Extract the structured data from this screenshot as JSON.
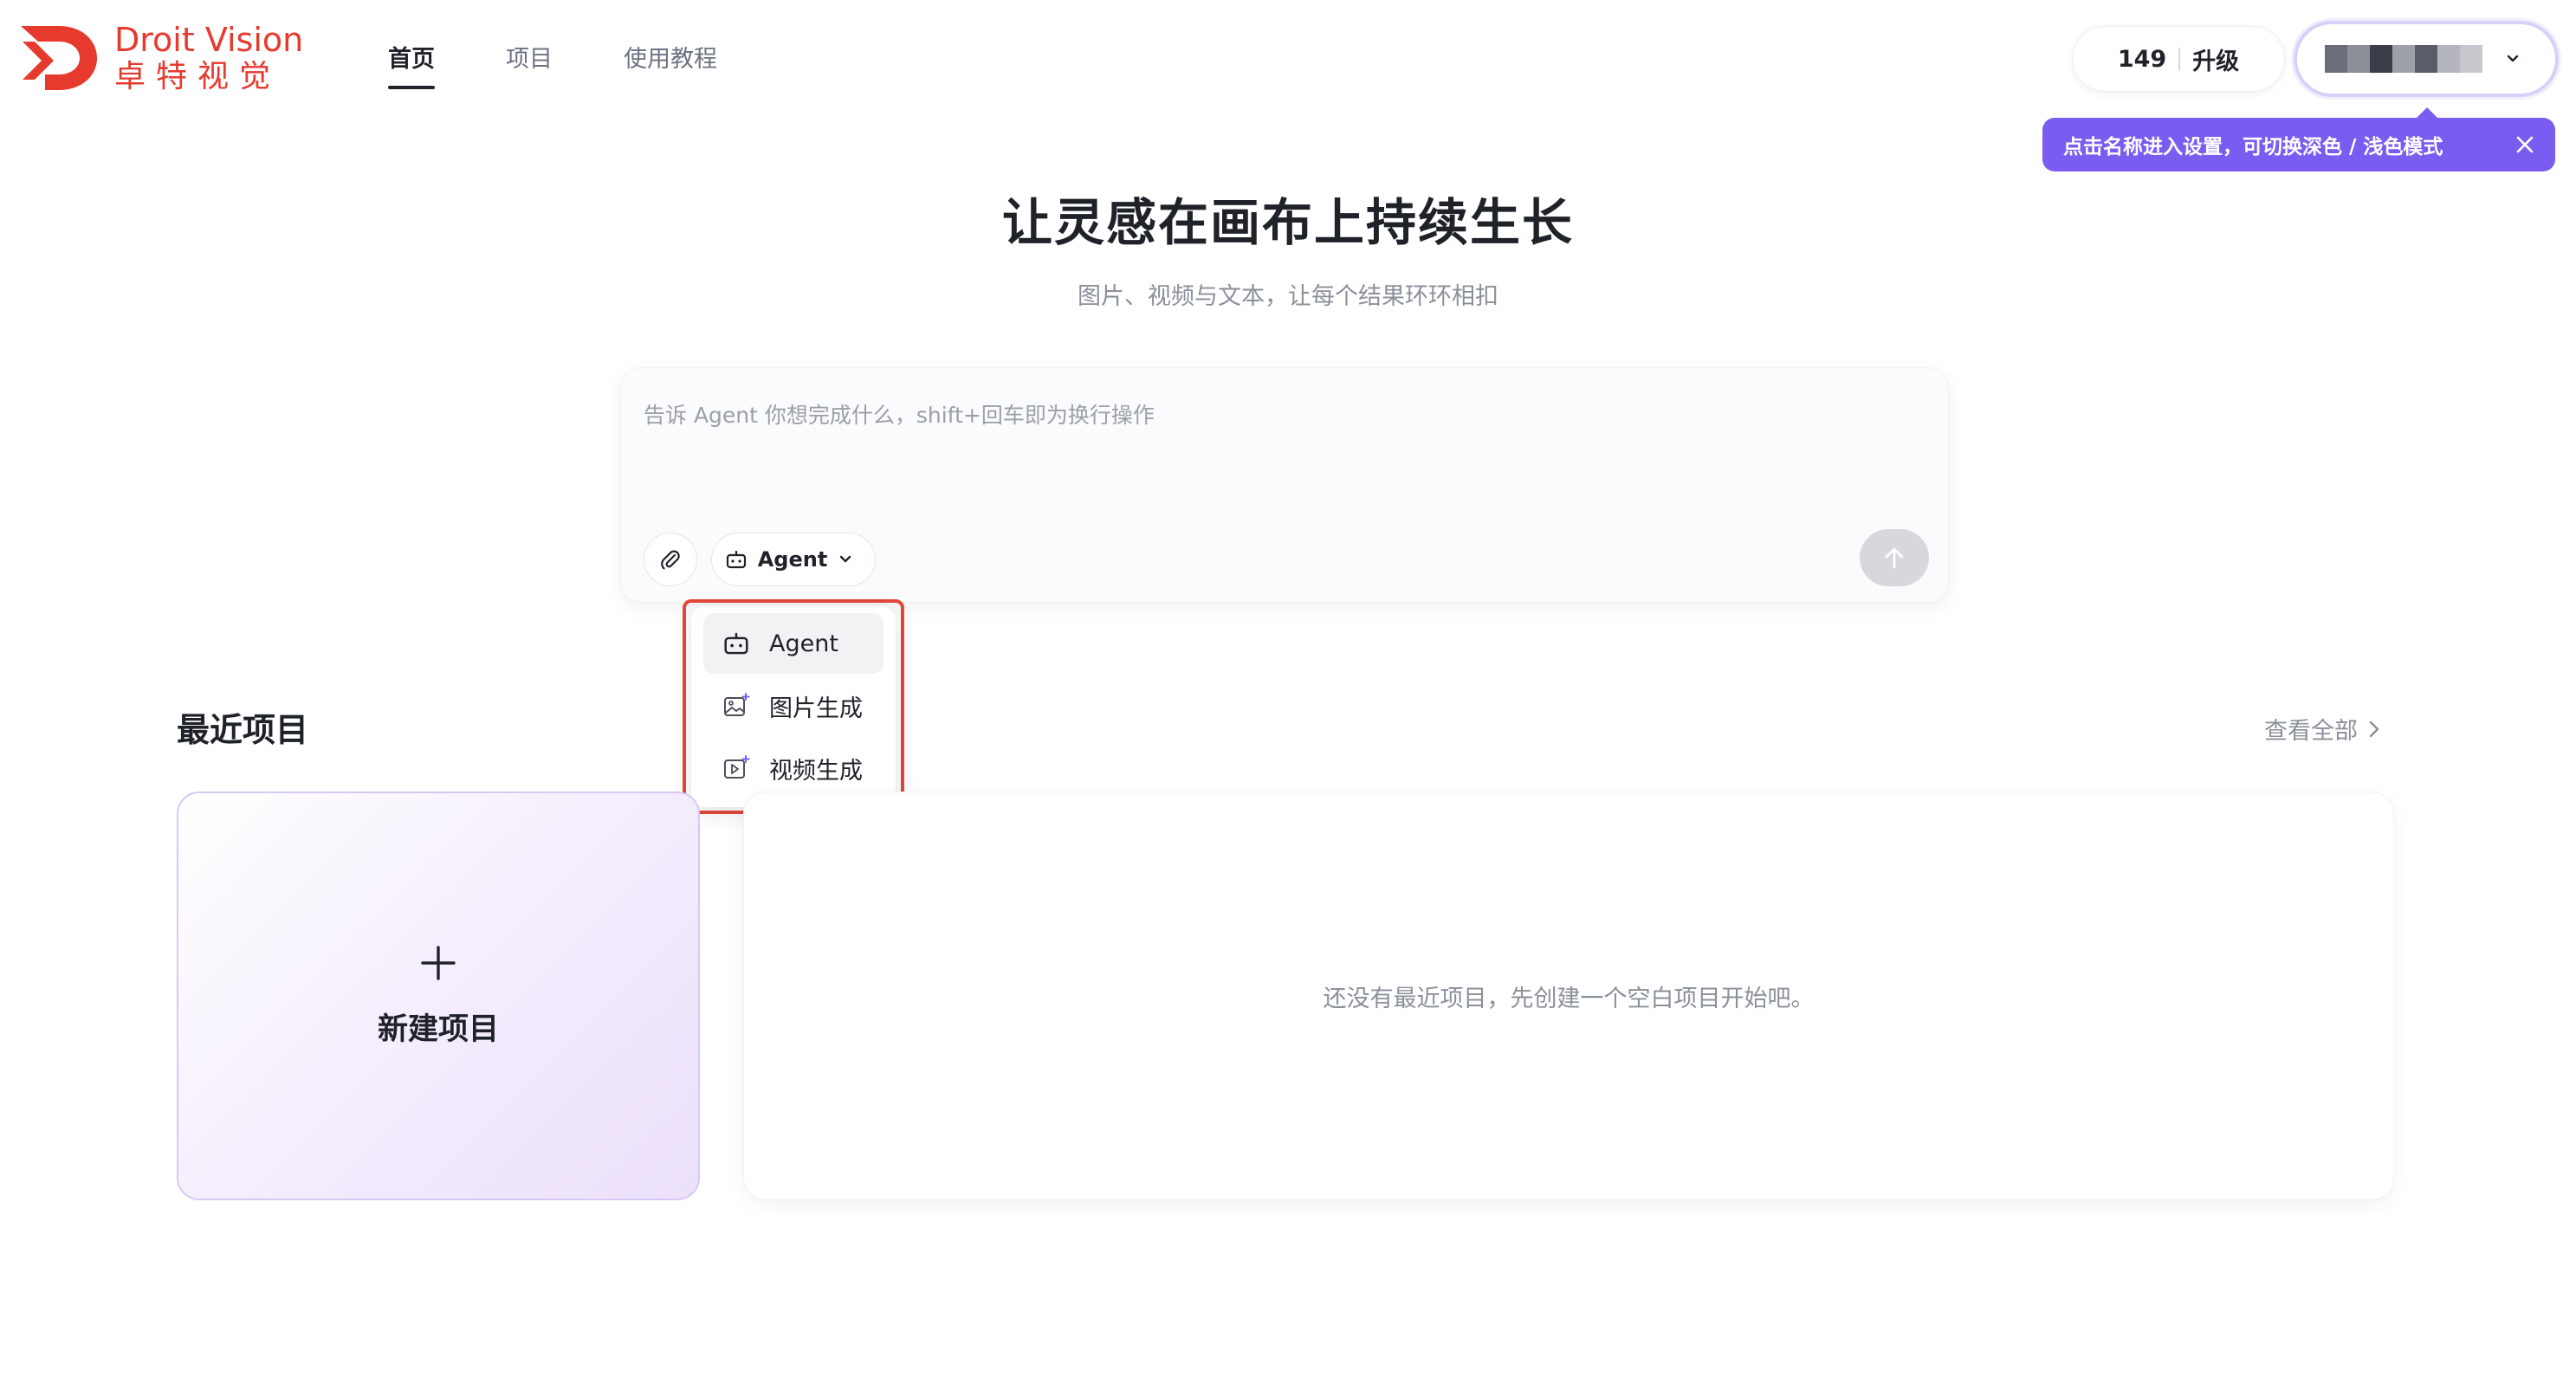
{
  "brand": {
    "name_en": "Droit Vision",
    "name_cn": "卓特视觉",
    "color": "#e63a2e"
  },
  "nav": {
    "items": [
      {
        "label": "首页",
        "active": true
      },
      {
        "label": "项目",
        "active": false
      },
      {
        "label": "使用教程",
        "active": false
      }
    ]
  },
  "account": {
    "credits": "149",
    "upgrade_label": "升级"
  },
  "tooltip": {
    "text": "点击名称进入设置，可切换深色 / 浅色模式",
    "color": "#7b5cf0"
  },
  "hero": {
    "title": "让灵感在画布上持续生长",
    "subtitle": "图片、视频与文本，让每个结果环环相扣"
  },
  "prompt": {
    "placeholder": "告诉 Agent 你想完成什么，shift+回车即为换行操作",
    "mode_label": "Agent"
  },
  "mode_menu": {
    "items": [
      {
        "label": "Agent",
        "icon": "robot-icon",
        "selected": true
      },
      {
        "label": "图片生成",
        "icon": "image-sparkle-icon",
        "selected": false
      },
      {
        "label": "视频生成",
        "icon": "video-sparkle-icon",
        "selected": false
      }
    ],
    "highlight_color": "#e5483a"
  },
  "recent": {
    "title": "最近项目",
    "view_all_label": "查看全部",
    "new_project_label": "新建项目",
    "empty_text": "还没有最近项目，先创建一个空白项目开始吧。"
  }
}
